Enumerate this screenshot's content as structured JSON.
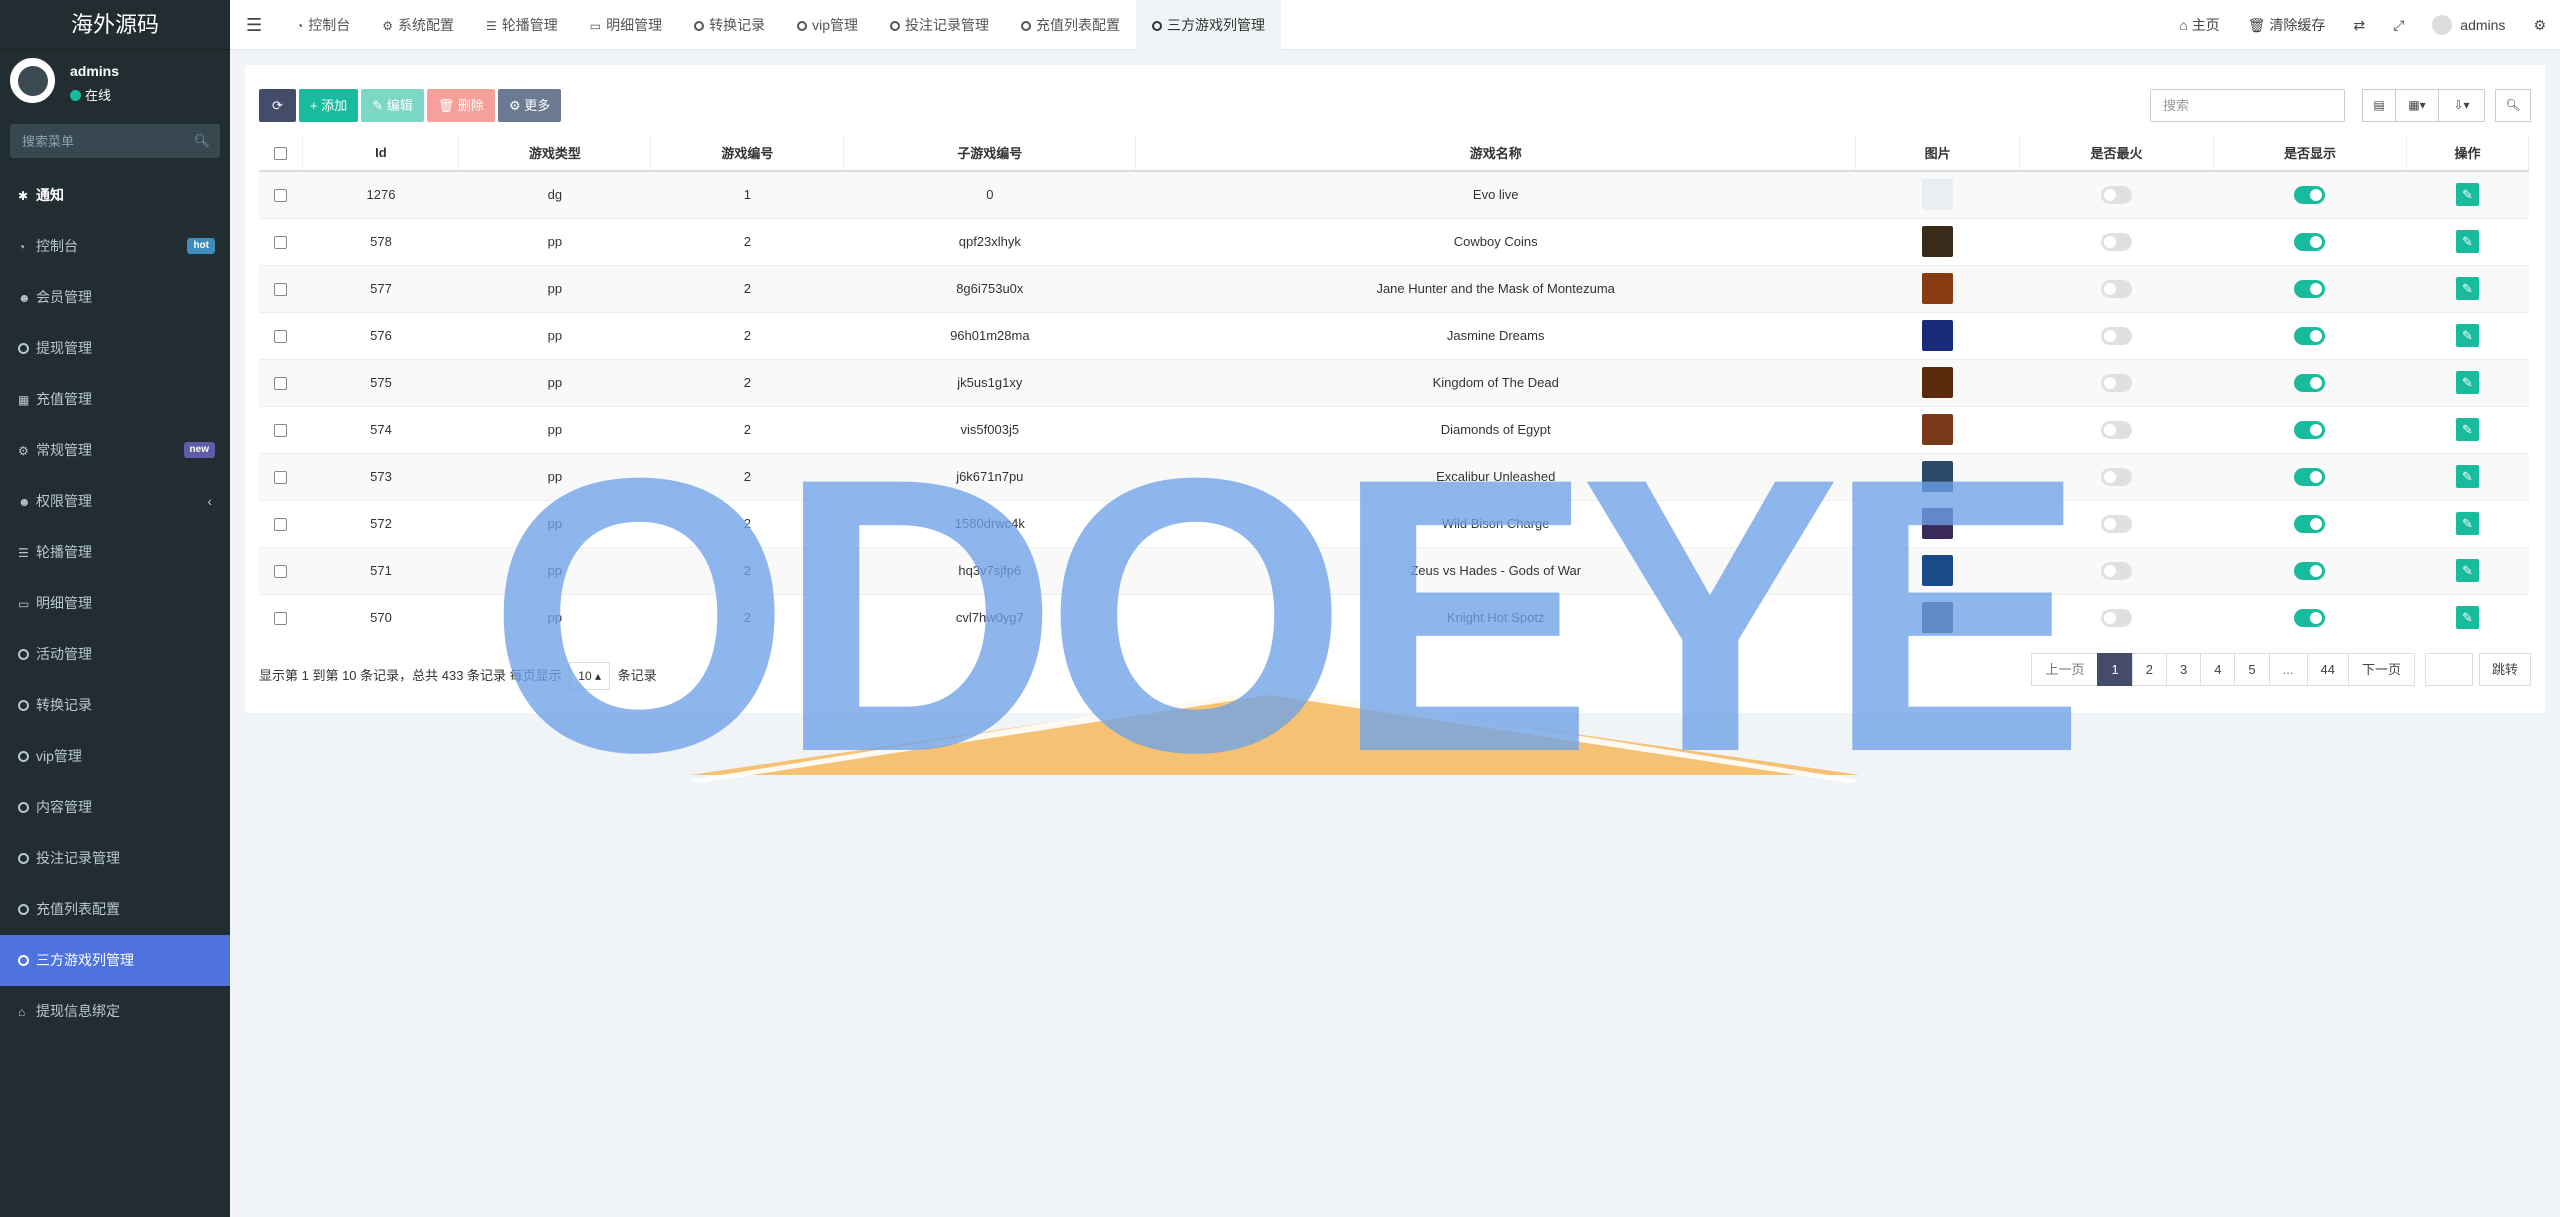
{
  "brand": "海外源码",
  "user": {
    "name": "admins",
    "status": "在线"
  },
  "sidebar": {
    "search_placeholder": "搜索菜单",
    "items": [
      {
        "label": "通知",
        "icon": "gear-icon",
        "glyph": "✱"
      },
      {
        "label": "控制台",
        "icon": "dashboard-icon",
        "glyph": "◔",
        "badge": "hot",
        "badge_color": "#3c8dbc"
      },
      {
        "label": "会员管理",
        "icon": "users-icon",
        "glyph": "☻"
      },
      {
        "label": "提现管理",
        "icon": "circle-icon",
        "glyph": "ring"
      },
      {
        "label": "充值管理",
        "icon": "grid-icon",
        "glyph": "▦"
      },
      {
        "label": "常规管理",
        "icon": "cogs-icon",
        "glyph": "⚙",
        "badge": "new",
        "badge_color": "#605ca8"
      },
      {
        "label": "权限管理",
        "icon": "group-icon",
        "glyph": "☻",
        "chevron": "‹"
      },
      {
        "label": "轮播管理",
        "icon": "list-icon",
        "glyph": "☰"
      },
      {
        "label": "明细管理",
        "icon": "calendar-icon",
        "glyph": "▭"
      },
      {
        "label": "活动管理",
        "icon": "circle-icon",
        "glyph": "ring"
      },
      {
        "label": "转换记录",
        "icon": "circle-icon",
        "glyph": "ring"
      },
      {
        "label": "vip管理",
        "icon": "circle-icon",
        "glyph": "ring"
      },
      {
        "label": "内容管理",
        "icon": "circle-icon",
        "glyph": "ring"
      },
      {
        "label": "投注记录管理",
        "icon": "circle-icon",
        "glyph": "ring"
      },
      {
        "label": "充值列表配置",
        "icon": "circle-icon",
        "glyph": "ring"
      },
      {
        "label": "三方游戏列管理",
        "icon": "circle-icon",
        "glyph": "ring"
      },
      {
        "label": "提现信息绑定",
        "icon": "bank-icon",
        "glyph": "⌂"
      }
    ]
  },
  "tabs": [
    {
      "label": "控制台",
      "glyph": "◔"
    },
    {
      "label": "系统配置",
      "glyph": "⚙"
    },
    {
      "label": "轮播管理",
      "glyph": "☰"
    },
    {
      "label": "明细管理",
      "glyph": "▭"
    },
    {
      "label": "转换记录",
      "glyph": "ring"
    },
    {
      "label": "vip管理",
      "glyph": "ring"
    },
    {
      "label": "投注记录管理",
      "glyph": "ring"
    },
    {
      "label": "充值列表配置",
      "glyph": "ring"
    },
    {
      "label": "三方游戏列管理",
      "glyph": "ring"
    }
  ],
  "topright": {
    "home": "主页",
    "clear_cache": "清除缓存",
    "admin": "admins"
  },
  "toolbar": {
    "add": "添加",
    "edit": "编辑",
    "delete": "删除",
    "more": "更多",
    "search_placeholder": "搜索"
  },
  "table": {
    "headers": [
      "Id",
      "游戏类型",
      "游戏编号",
      "子游戏编号",
      "游戏名称",
      "图片",
      "是否最火",
      "是否显示",
      "操作"
    ],
    "rows": [
      {
        "id": "1276",
        "type": "dg",
        "num": "1",
        "sub": "0",
        "name": "Evo live",
        "img": "#e8eef2",
        "hot": false,
        "show": true
      },
      {
        "id": "578",
        "type": "pp",
        "num": "2",
        "sub": "qpf23xlhyk",
        "name": "Cowboy Coins",
        "img": "#3a2a1a",
        "hot": false,
        "show": true
      },
      {
        "id": "577",
        "type": "pp",
        "num": "2",
        "sub": "8g6i753u0x",
        "name": "Jane Hunter and the Mask of Montezuma",
        "img": "#8a3a10",
        "hot": false,
        "show": true
      },
      {
        "id": "576",
        "type": "pp",
        "num": "2",
        "sub": "96h01m28ma",
        "name": "Jasmine Dreams",
        "img": "#1a2a7a",
        "hot": false,
        "show": true
      },
      {
        "id": "575",
        "type": "pp",
        "num": "2",
        "sub": "jk5us1g1xy",
        "name": "Kingdom of The Dead",
        "img": "#5a2a0a",
        "hot": false,
        "show": true
      },
      {
        "id": "574",
        "type": "pp",
        "num": "2",
        "sub": "vis5f003j5",
        "name": "Diamonds of Egypt",
        "img": "#7a3a1a",
        "hot": false,
        "show": true
      },
      {
        "id": "573",
        "type": "pp",
        "num": "2",
        "sub": "j6k671n7pu",
        "name": "Excalibur Unleashed",
        "img": "#2a4a6a",
        "hot": false,
        "show": true
      },
      {
        "id": "572",
        "type": "pp",
        "num": "2",
        "sub": "1580drwc4k",
        "name": "Wild Bison Charge",
        "img": "#3a2a5a",
        "hot": false,
        "show": true
      },
      {
        "id": "571",
        "type": "pp",
        "num": "2",
        "sub": "hq3v7sjfp6",
        "name": "Zeus vs Hades - Gods of War",
        "img": "#1a4a8a",
        "hot": false,
        "show": true
      },
      {
        "id": "570",
        "type": "pp",
        "num": "2",
        "sub": "cvl7hw0yg7",
        "name": "Knight Hot Spotz",
        "img": "#2a3a5a",
        "hot": false,
        "show": true
      }
    ]
  },
  "footer": {
    "prefix": "显示第 1 到第 10 条记录，总共 433 条记录 每页显示",
    "per_page": "10",
    "suffix": "条记录"
  },
  "pager": {
    "prev": "上一页",
    "pages": [
      "1",
      "2",
      "3",
      "4",
      "5",
      "...",
      "44"
    ],
    "next": "下一页",
    "go": "跳转"
  },
  "watermark": "ODOEYE",
  "colors": {
    "accent": "#18bc9c",
    "sidebar_bg": "#222d32",
    "active_menu": "#4e73df",
    "watermark_blue": "#6fa2e8",
    "watermark_orange": "#f5b85a"
  }
}
